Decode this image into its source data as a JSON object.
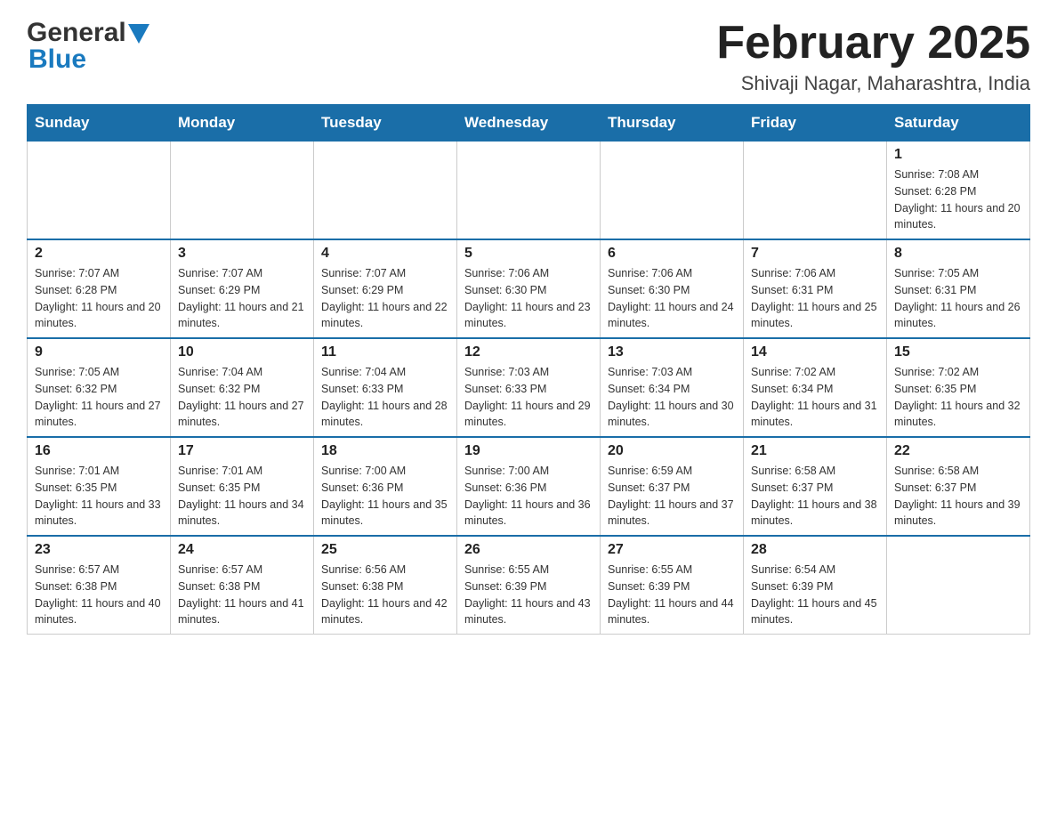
{
  "header": {
    "logo_general": "General",
    "logo_blue": "Blue",
    "title": "February 2025",
    "subtitle": "Shivaji Nagar, Maharashtra, India"
  },
  "days_of_week": [
    "Sunday",
    "Monday",
    "Tuesday",
    "Wednesday",
    "Thursday",
    "Friday",
    "Saturday"
  ],
  "weeks": [
    [
      {
        "day": "",
        "info": ""
      },
      {
        "day": "",
        "info": ""
      },
      {
        "day": "",
        "info": ""
      },
      {
        "day": "",
        "info": ""
      },
      {
        "day": "",
        "info": ""
      },
      {
        "day": "",
        "info": ""
      },
      {
        "day": "1",
        "info": "Sunrise: 7:08 AM\nSunset: 6:28 PM\nDaylight: 11 hours and 20 minutes."
      }
    ],
    [
      {
        "day": "2",
        "info": "Sunrise: 7:07 AM\nSunset: 6:28 PM\nDaylight: 11 hours and 20 minutes."
      },
      {
        "day": "3",
        "info": "Sunrise: 7:07 AM\nSunset: 6:29 PM\nDaylight: 11 hours and 21 minutes."
      },
      {
        "day": "4",
        "info": "Sunrise: 7:07 AM\nSunset: 6:29 PM\nDaylight: 11 hours and 22 minutes."
      },
      {
        "day": "5",
        "info": "Sunrise: 7:06 AM\nSunset: 6:30 PM\nDaylight: 11 hours and 23 minutes."
      },
      {
        "day": "6",
        "info": "Sunrise: 7:06 AM\nSunset: 6:30 PM\nDaylight: 11 hours and 24 minutes."
      },
      {
        "day": "7",
        "info": "Sunrise: 7:06 AM\nSunset: 6:31 PM\nDaylight: 11 hours and 25 minutes."
      },
      {
        "day": "8",
        "info": "Sunrise: 7:05 AM\nSunset: 6:31 PM\nDaylight: 11 hours and 26 minutes."
      }
    ],
    [
      {
        "day": "9",
        "info": "Sunrise: 7:05 AM\nSunset: 6:32 PM\nDaylight: 11 hours and 27 minutes."
      },
      {
        "day": "10",
        "info": "Sunrise: 7:04 AM\nSunset: 6:32 PM\nDaylight: 11 hours and 27 minutes."
      },
      {
        "day": "11",
        "info": "Sunrise: 7:04 AM\nSunset: 6:33 PM\nDaylight: 11 hours and 28 minutes."
      },
      {
        "day": "12",
        "info": "Sunrise: 7:03 AM\nSunset: 6:33 PM\nDaylight: 11 hours and 29 minutes."
      },
      {
        "day": "13",
        "info": "Sunrise: 7:03 AM\nSunset: 6:34 PM\nDaylight: 11 hours and 30 minutes."
      },
      {
        "day": "14",
        "info": "Sunrise: 7:02 AM\nSunset: 6:34 PM\nDaylight: 11 hours and 31 minutes."
      },
      {
        "day": "15",
        "info": "Sunrise: 7:02 AM\nSunset: 6:35 PM\nDaylight: 11 hours and 32 minutes."
      }
    ],
    [
      {
        "day": "16",
        "info": "Sunrise: 7:01 AM\nSunset: 6:35 PM\nDaylight: 11 hours and 33 minutes."
      },
      {
        "day": "17",
        "info": "Sunrise: 7:01 AM\nSunset: 6:35 PM\nDaylight: 11 hours and 34 minutes."
      },
      {
        "day": "18",
        "info": "Sunrise: 7:00 AM\nSunset: 6:36 PM\nDaylight: 11 hours and 35 minutes."
      },
      {
        "day": "19",
        "info": "Sunrise: 7:00 AM\nSunset: 6:36 PM\nDaylight: 11 hours and 36 minutes."
      },
      {
        "day": "20",
        "info": "Sunrise: 6:59 AM\nSunset: 6:37 PM\nDaylight: 11 hours and 37 minutes."
      },
      {
        "day": "21",
        "info": "Sunrise: 6:58 AM\nSunset: 6:37 PM\nDaylight: 11 hours and 38 minutes."
      },
      {
        "day": "22",
        "info": "Sunrise: 6:58 AM\nSunset: 6:37 PM\nDaylight: 11 hours and 39 minutes."
      }
    ],
    [
      {
        "day": "23",
        "info": "Sunrise: 6:57 AM\nSunset: 6:38 PM\nDaylight: 11 hours and 40 minutes."
      },
      {
        "day": "24",
        "info": "Sunrise: 6:57 AM\nSunset: 6:38 PM\nDaylight: 11 hours and 41 minutes."
      },
      {
        "day": "25",
        "info": "Sunrise: 6:56 AM\nSunset: 6:38 PM\nDaylight: 11 hours and 42 minutes."
      },
      {
        "day": "26",
        "info": "Sunrise: 6:55 AM\nSunset: 6:39 PM\nDaylight: 11 hours and 43 minutes."
      },
      {
        "day": "27",
        "info": "Sunrise: 6:55 AM\nSunset: 6:39 PM\nDaylight: 11 hours and 44 minutes."
      },
      {
        "day": "28",
        "info": "Sunrise: 6:54 AM\nSunset: 6:39 PM\nDaylight: 11 hours and 45 minutes."
      },
      {
        "day": "",
        "info": ""
      }
    ]
  ]
}
